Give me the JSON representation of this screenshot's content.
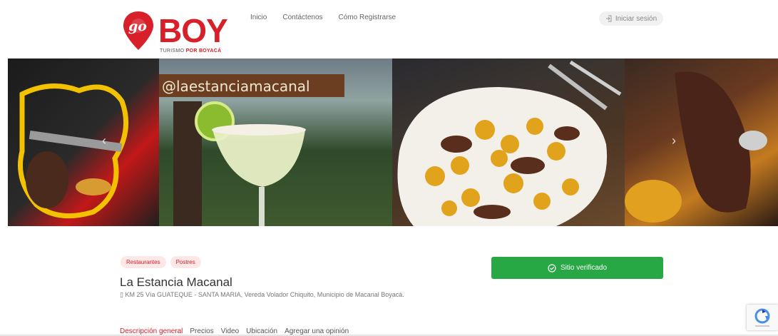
{
  "header": {
    "logo": {
      "go": "go",
      "brand": "BOY",
      "tagline_prefix": "TURISMO ",
      "tagline_bold": "POR BOYACÁ",
      "brand_color": "#d8202a"
    },
    "nav": [
      {
        "label": "Inicio"
      },
      {
        "label": "Contáctenos"
      },
      {
        "label": "Cómo Registrarse"
      }
    ],
    "login": {
      "label": "Iniciar sesión",
      "icon": "login-icon"
    }
  },
  "gallery": {
    "photos": [
      {
        "name": "steak-tongs-photo"
      },
      {
        "name": "margarita-photo",
        "sign_text": "@laestanciamacanal"
      },
      {
        "name": "meat-potatoes-photo"
      },
      {
        "name": "grilled-ribs-photo"
      }
    ],
    "prev_icon": "chevron-left-icon",
    "next_icon": "chevron-right-icon"
  },
  "listing": {
    "tags": [
      "Restaurantes",
      "Postres"
    ],
    "title": "La Estancia Macanal",
    "address_icon": "map-marker-icon",
    "address": "KM 25 Vía GUATEQUE - SANTA MARIA, Vereda Volador Chiquito, Municipio de Macanal Boyacá.",
    "verified": {
      "label": "Sitio verificado",
      "icon": "check-circle-icon",
      "color": "#28a745"
    }
  },
  "tabs": [
    {
      "label": "Descripción general",
      "active": true
    },
    {
      "label": "Precios"
    },
    {
      "label": "Video"
    },
    {
      "label": "Ubicación"
    },
    {
      "label": "Agregar una opinión"
    }
  ]
}
